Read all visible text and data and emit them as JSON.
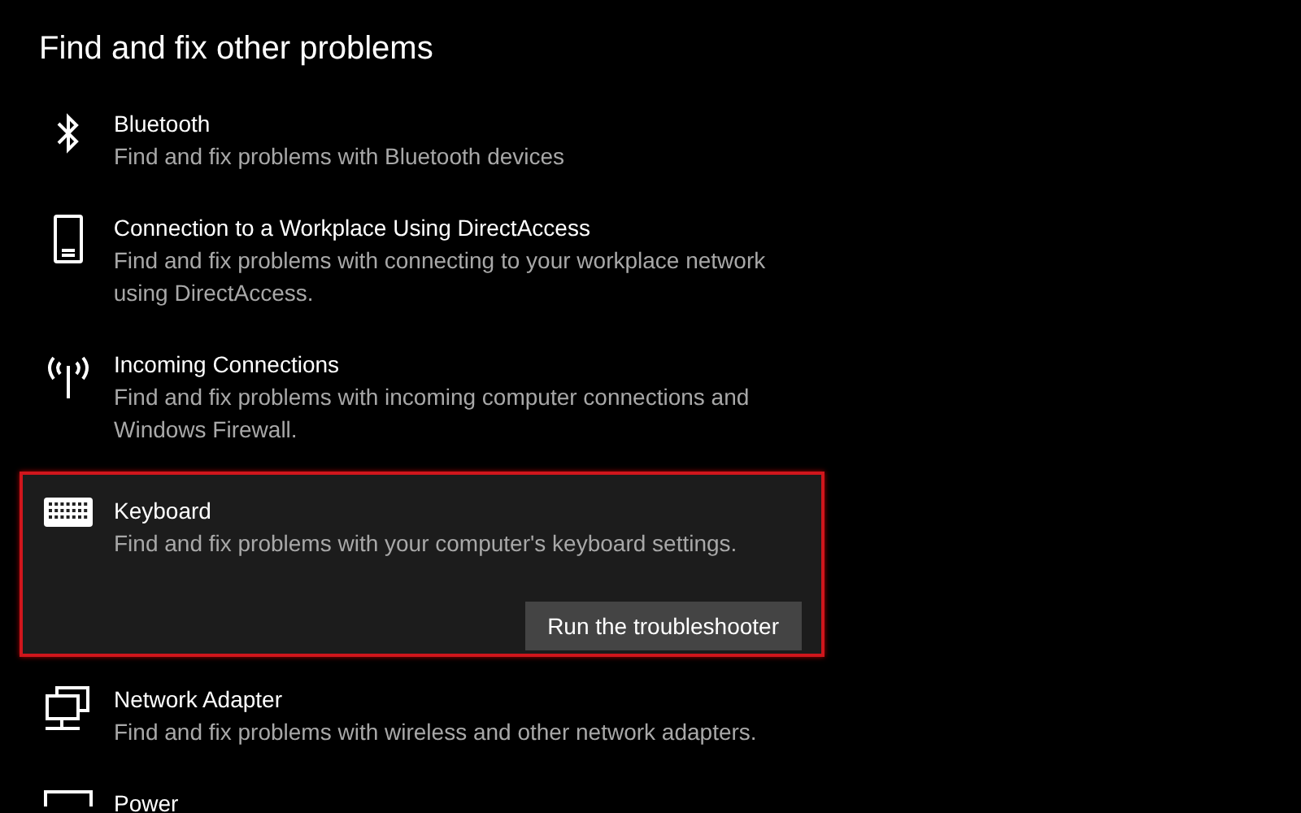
{
  "heading": "Find and fix other problems",
  "items": [
    {
      "kind": "bluetooth",
      "title": "Bluetooth",
      "description": "Find and fix problems with Bluetooth devices",
      "expanded": false,
      "highlighted": false
    },
    {
      "kind": "phone",
      "title": "Connection to a Workplace Using DirectAccess",
      "description": "Find and fix problems with connecting to your workplace network using DirectAccess.",
      "expanded": false,
      "highlighted": false
    },
    {
      "kind": "antenna",
      "title": "Incoming Connections",
      "description": "Find and fix problems with incoming computer connections and Windows Firewall.",
      "expanded": false,
      "highlighted": false
    },
    {
      "kind": "keyboard",
      "title": "Keyboard",
      "description": "Find and fix problems with your computer's keyboard settings.",
      "expanded": true,
      "highlighted": true,
      "button": "Run the troubleshooter"
    },
    {
      "kind": "network",
      "title": "Network Adapter",
      "description": "Find and fix problems with wireless and other network adapters.",
      "expanded": false,
      "highlighted": false
    },
    {
      "kind": "power",
      "title": "Power",
      "expanded": false,
      "highlighted": false
    }
  ]
}
